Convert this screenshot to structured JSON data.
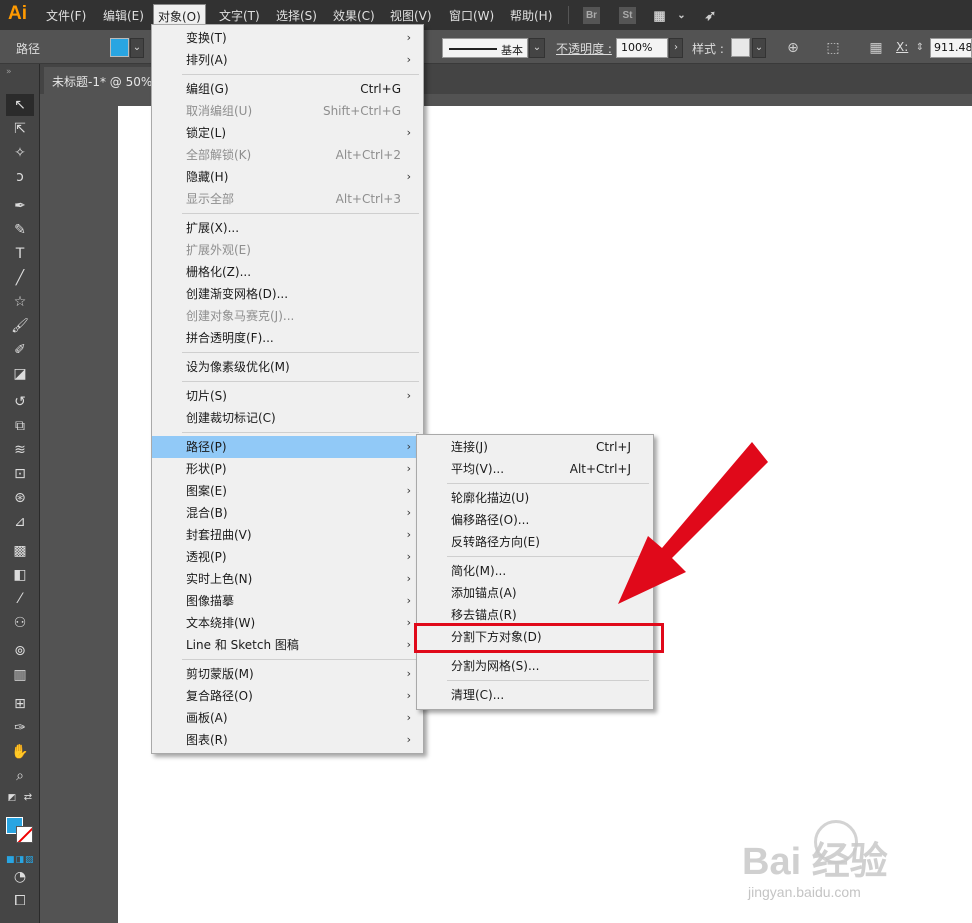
{
  "app": {
    "logo": "Ai"
  },
  "menubar": {
    "items": [
      "文件(F)",
      "编辑(E)",
      "对象(O)",
      "文字(T)",
      "选择(S)",
      "效果(C)",
      "视图(V)",
      "窗口(W)",
      "帮助(H)"
    ],
    "open_item": "对象(O)",
    "icons": {
      "bridge": "Br",
      "stock": "St"
    }
  },
  "controlbar": {
    "selection_label": "路径",
    "stroke_style": "基本",
    "opacity_label": "不透明度 :",
    "opacity_value": "100%",
    "style_label": "样式 :",
    "x_label": "X:",
    "x_value": "911.48"
  },
  "document": {
    "tab_title": "未标题-1* @ 50%"
  },
  "object_menu": {
    "items": [
      {
        "label": "变换(T)",
        "shortcut": "",
        "submenu": true,
        "disabled": false
      },
      {
        "label": "排列(A)",
        "shortcut": "",
        "submenu": true,
        "disabled": false
      },
      {
        "label": "编组(G)",
        "shortcut": "Ctrl+G",
        "submenu": false,
        "disabled": false
      },
      {
        "label": "取消编组(U)",
        "shortcut": "Shift+Ctrl+G",
        "submenu": false,
        "disabled": true
      },
      {
        "label": "锁定(L)",
        "shortcut": "",
        "submenu": true,
        "disabled": false
      },
      {
        "label": "全部解锁(K)",
        "shortcut": "Alt+Ctrl+2",
        "submenu": false,
        "disabled": true
      },
      {
        "label": "隐藏(H)",
        "shortcut": "",
        "submenu": true,
        "disabled": false
      },
      {
        "label": "显示全部",
        "shortcut": "Alt+Ctrl+3",
        "submenu": false,
        "disabled": true
      },
      {
        "label": "扩展(X)...",
        "shortcut": "",
        "submenu": false,
        "disabled": false
      },
      {
        "label": "扩展外观(E)",
        "shortcut": "",
        "submenu": false,
        "disabled": true
      },
      {
        "label": "栅格化(Z)...",
        "shortcut": "",
        "submenu": false,
        "disabled": false
      },
      {
        "label": "创建渐变网格(D)...",
        "shortcut": "",
        "submenu": false,
        "disabled": false
      },
      {
        "label": "创建对象马赛克(J)...",
        "shortcut": "",
        "submenu": false,
        "disabled": true
      },
      {
        "label": "拼合透明度(F)...",
        "shortcut": "",
        "submenu": false,
        "disabled": false
      },
      {
        "label": "设为像素级优化(M)",
        "shortcut": "",
        "submenu": false,
        "disabled": false
      },
      {
        "label": "切片(S)",
        "shortcut": "",
        "submenu": true,
        "disabled": false
      },
      {
        "label": "创建裁切标记(C)",
        "shortcut": "",
        "submenu": false,
        "disabled": false
      },
      {
        "label": "路径(P)",
        "shortcut": "",
        "submenu": true,
        "disabled": false,
        "highlighted": true
      },
      {
        "label": "形状(P)",
        "shortcut": "",
        "submenu": true,
        "disabled": false
      },
      {
        "label": "图案(E)",
        "shortcut": "",
        "submenu": true,
        "disabled": false
      },
      {
        "label": "混合(B)",
        "shortcut": "",
        "submenu": true,
        "disabled": false
      },
      {
        "label": "封套扭曲(V)",
        "shortcut": "",
        "submenu": true,
        "disabled": false
      },
      {
        "label": "透视(P)",
        "shortcut": "",
        "submenu": true,
        "disabled": false
      },
      {
        "label": "实时上色(N)",
        "shortcut": "",
        "submenu": true,
        "disabled": false
      },
      {
        "label": "图像描摹",
        "shortcut": "",
        "submenu": true,
        "disabled": false
      },
      {
        "label": "文本绕排(W)",
        "shortcut": "",
        "submenu": true,
        "disabled": false
      },
      {
        "label": "Line 和 Sketch 图稿",
        "shortcut": "",
        "submenu": true,
        "disabled": false
      },
      {
        "label": "剪切蒙版(M)",
        "shortcut": "",
        "submenu": true,
        "disabled": false
      },
      {
        "label": "复合路径(O)",
        "shortcut": "",
        "submenu": true,
        "disabled": false
      },
      {
        "label": "画板(A)",
        "shortcut": "",
        "submenu": true,
        "disabled": false
      },
      {
        "label": "图表(R)",
        "shortcut": "",
        "submenu": true,
        "disabled": false
      }
    ]
  },
  "path_submenu": {
    "items": [
      {
        "label": "连接(J)",
        "shortcut": "Ctrl+J"
      },
      {
        "label": "平均(V)...",
        "shortcut": "Alt+Ctrl+J"
      },
      {
        "label": "轮廓化描边(U)",
        "shortcut": ""
      },
      {
        "label": "偏移路径(O)...",
        "shortcut": ""
      },
      {
        "label": "反转路径方向(E)",
        "shortcut": ""
      },
      {
        "label": "简化(M)...",
        "shortcut": ""
      },
      {
        "label": "添加锚点(A)",
        "shortcut": ""
      },
      {
        "label": "移去锚点(R)",
        "shortcut": ""
      },
      {
        "label": "分割下方对象(D)",
        "shortcut": "",
        "emphasized": true
      },
      {
        "label": "分割为网格(S)...",
        "shortcut": ""
      },
      {
        "label": "清理(C)...",
        "shortcut": ""
      }
    ]
  },
  "annotation": {
    "arrow_color": "#e0091a",
    "box_color": "#e0091a"
  },
  "watermark": {
    "main": "Bai 经验",
    "sub": "jingyan.baidu.com"
  }
}
